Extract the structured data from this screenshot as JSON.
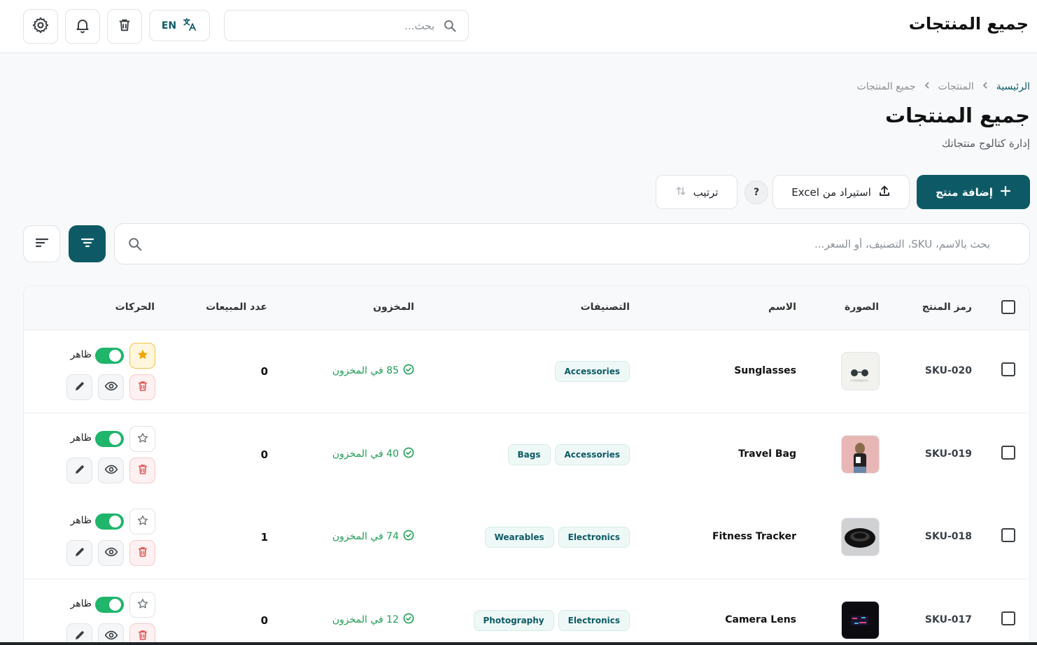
{
  "header": {
    "app_title": "جميع المنتجات",
    "search_placeholder": "بحث...",
    "lang_label": "EN"
  },
  "breadcrumb": {
    "home": "الرئيسية",
    "products": "المنتجات",
    "current": "جميع المنتجات"
  },
  "page": {
    "title": "جميع المنتجات",
    "subtitle": "إدارة كتالوج منتجاتك"
  },
  "actions": {
    "add_product": "إضافة منتج",
    "import_excel": "استيراد من Excel",
    "help": "?",
    "sort": "ترتيب"
  },
  "filter": {
    "search_placeholder": "بحث بالاسم، SKU، التصنيف، أو السعر..."
  },
  "table": {
    "columns": {
      "sku": "رمز المنتج",
      "image": "الصورة",
      "name": "الاسم",
      "categories": "التصنيفات",
      "stock": "المخزون",
      "sales": "عدد المبيعات",
      "actions": "الحركات"
    },
    "rows": [
      {
        "sku": "SKU-020",
        "name": "Sunglasses",
        "categories": [
          "Accessories"
        ],
        "stock": "85 في المخزون",
        "sales": "0",
        "featured": true,
        "visibility": "ظاهر",
        "image": "sunglasses-thumb"
      },
      {
        "sku": "SKU-019",
        "name": "Travel Bag",
        "categories": [
          "Accessories",
          "Bags"
        ],
        "stock": "40 في المخزون",
        "sales": "0",
        "featured": false,
        "visibility": "ظاهر",
        "image": "travel-bag-thumb"
      },
      {
        "sku": "SKU-018",
        "name": "Fitness Tracker",
        "categories": [
          "Electronics",
          "Wearables"
        ],
        "stock": "74 في المخزون",
        "sales": "1",
        "featured": false,
        "visibility": "ظاهر",
        "image": "fitness-tracker-thumb"
      },
      {
        "sku": "SKU-017",
        "name": "Camera Lens",
        "categories": [
          "Electronics",
          "Photography"
        ],
        "stock": "12 في المخزون",
        "sales": "0",
        "featured": false,
        "visibility": "ظاهر",
        "image": "camera-lens-thumb"
      }
    ]
  },
  "colors": {
    "primary": "#0d5a66",
    "success": "#1f9d55",
    "toggle_on": "#1fb56a",
    "danger": "#e05555",
    "star": "#f0a500"
  }
}
